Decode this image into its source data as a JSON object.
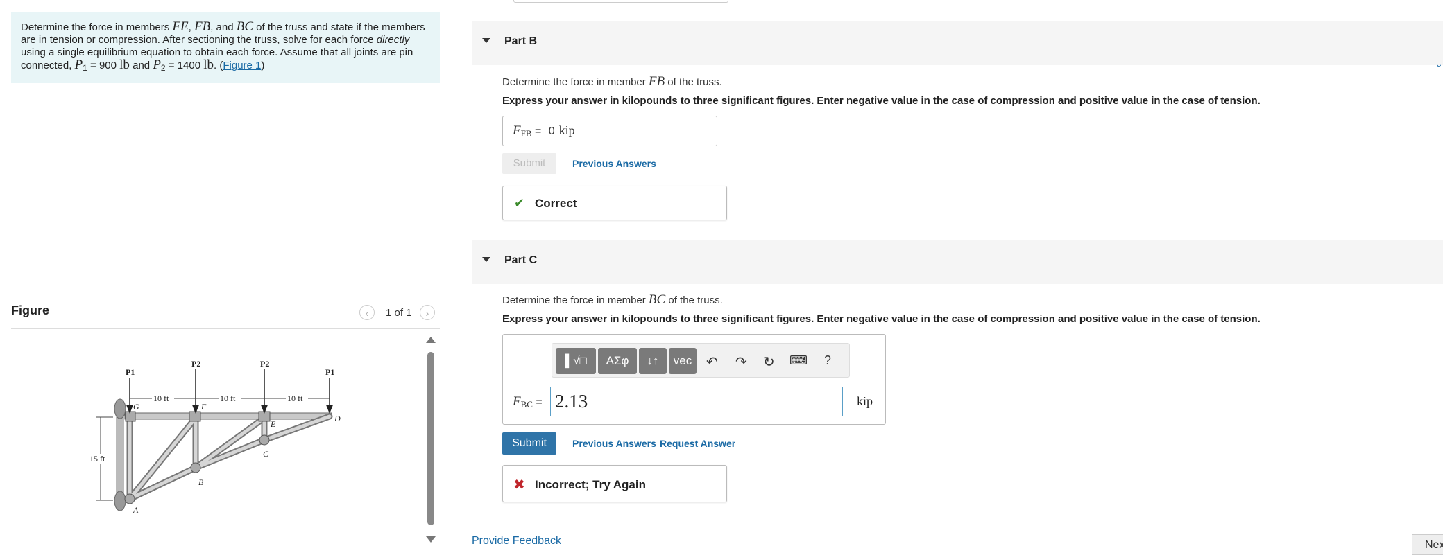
{
  "problem": {
    "text_1": "Determine the force in members ",
    "m_FE": "FE",
    "sep1": ", ",
    "m_FB": "FB",
    "sep2": ", and ",
    "m_BC": "BC",
    "text_2": " of the truss and state if the members are in tension or compression. After sectioning the truss, solve for each force ",
    "directly": "directly",
    "text_3": " using a single equilibrium equation to obtain each force. Assume that all joints are pin connected, ",
    "P1": "P",
    "P1_sub": "1",
    "P1_val": " = 900 ",
    "lb1": "lb",
    "and": " and ",
    "P2": "P",
    "P2_sub": "2",
    "P2_val": " = 1400 ",
    "lb2": "lb",
    "period": ". (",
    "figure_link": "Figure 1",
    "close": ")"
  },
  "figure": {
    "title": "Figure",
    "counter": "1 of 1",
    "labels": {
      "P1_left": "P1",
      "P2_left": "P2",
      "P2_right": "P2",
      "P1_right": "P1",
      "dim1": "10 ft",
      "dim2": "10 ft",
      "dim3": "10 ft",
      "height": "15 ft",
      "A": "A",
      "B": "B",
      "C": "C",
      "D": "D",
      "E": "E",
      "F": "F",
      "G": "G"
    }
  },
  "partB": {
    "header": "Part B",
    "prompt_pre": "Determine the force in member ",
    "prompt_member": "FB",
    "prompt_post": " of the truss.",
    "instructions": "Express your answer in kilopounds to three significant figures. Enter negative value in the case of compression and positive value in the case of tension.",
    "var": "F",
    "var_sub": "FB",
    "eq": " = ",
    "value": "0",
    "unit": "kip",
    "submit": "Submit",
    "previous": "Previous Answers",
    "feedback": "Correct"
  },
  "partC": {
    "header": "Part C",
    "prompt_pre": "Determine the force in member ",
    "prompt_member": "BC",
    "prompt_post": " of the truss.",
    "instructions": "Express your answer in kilopounds to three significant figures. Enter negative value in the case of compression and positive value in the case of tension.",
    "toolbar": {
      "templates": "▌√□",
      "greek": "ΑΣφ",
      "arrows": "↓↑",
      "vec": "vec",
      "undo": "↶",
      "redo": "↷",
      "reset": "↻",
      "keyboard": "⌨",
      "help": "?"
    },
    "var": "F",
    "var_sub": "BC",
    "eq": " = ",
    "value": "2.13",
    "unit": "kip",
    "submit": "Submit",
    "previous": "Previous Answers",
    "request": "Request Answer",
    "feedback": "Incorrect; Try Again"
  },
  "footer": {
    "provide_feedback": "Provide Feedback",
    "next": "Next"
  }
}
